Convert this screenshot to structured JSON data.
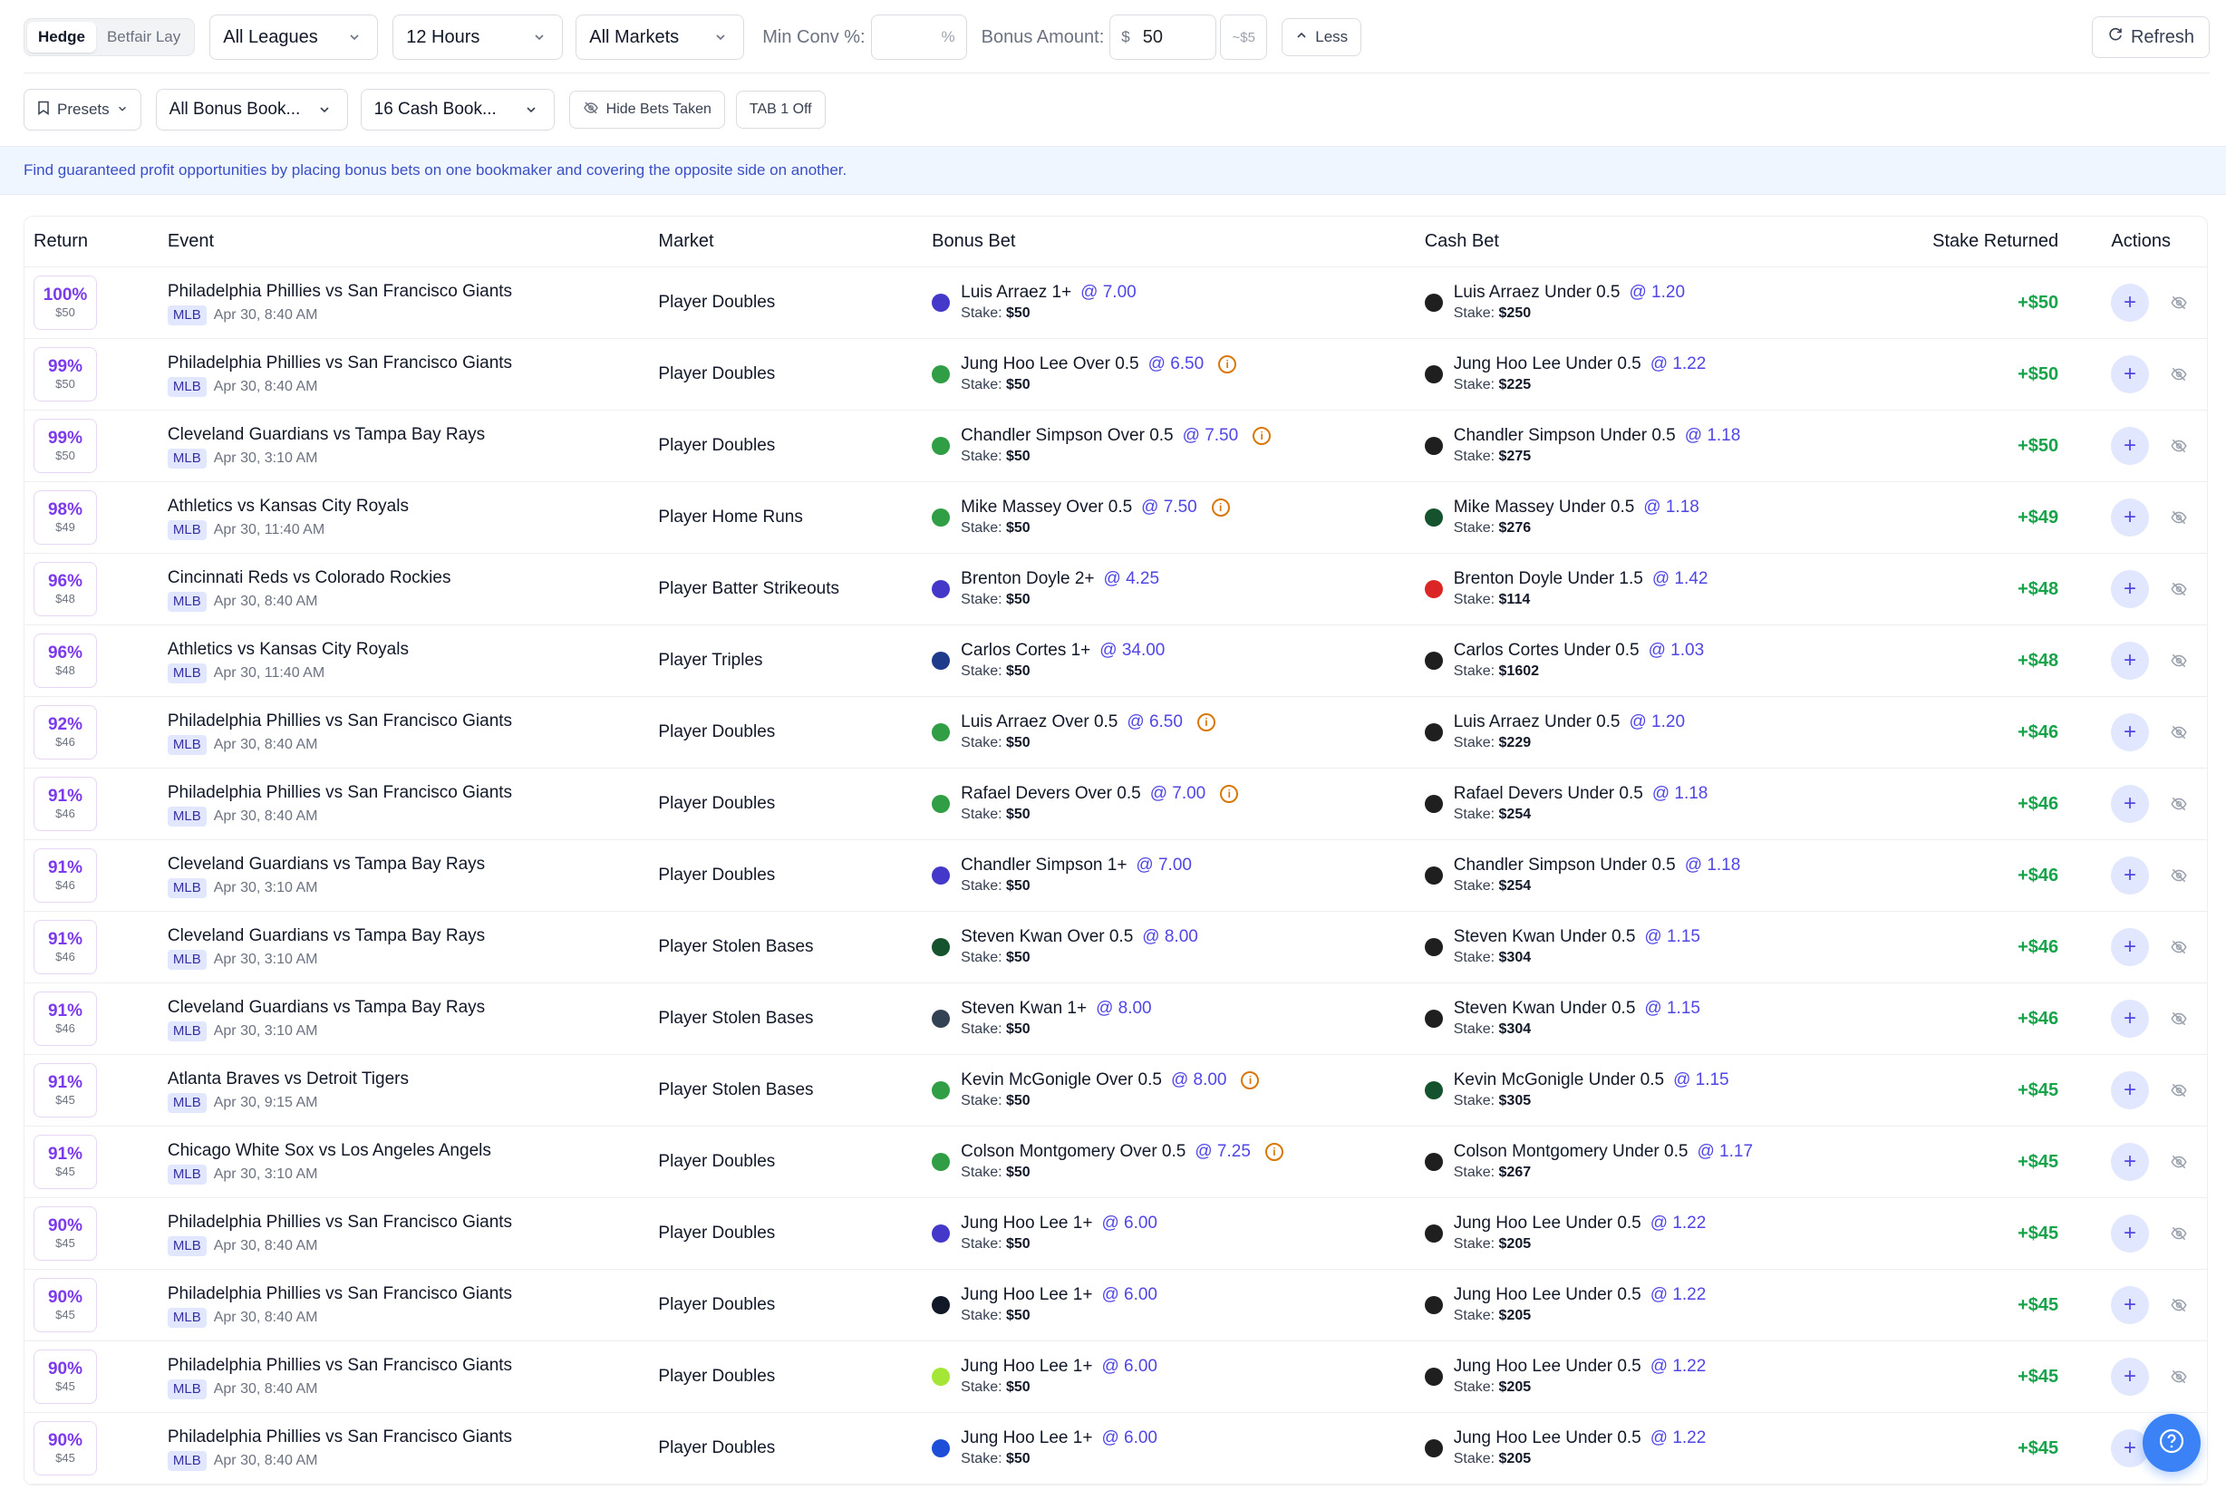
{
  "toolbar": {
    "mode_tabs": [
      "Hedge",
      "Betfair Lay"
    ],
    "league_select": "All Leagues",
    "time_select": "12 Hours",
    "market_select": "All Markets",
    "min_conv_label": "Min Conv %:",
    "min_conv_value": "",
    "min_conv_suffix": "%",
    "bonus_amount_label": "Bonus Amount:",
    "bonus_currency": "$",
    "bonus_amount_value": "50",
    "bonus_conv_hint": "~$5",
    "less_label": "Less",
    "refresh_label": "Refresh"
  },
  "filters": {
    "presets_label": "Presets",
    "bonus_books_select": "All Bonus Book...",
    "cash_books_select": "16 Cash Book...",
    "hide_bets_label": "Hide Bets Taken",
    "tab_toggle_label": "TAB 1 Off"
  },
  "info_text": "Find guaranteed profit opportunities by placing bonus bets on one bookmaker and covering the opposite side on another.",
  "columns": [
    "Return",
    "Event",
    "Market",
    "Bonus Bet",
    "Cash Bet",
    "Stake Returned",
    "Actions"
  ],
  "colors": {
    "accent": "#4f46e5",
    "profit": "#16a34a",
    "return": "#7c3aed",
    "warning": "#d97706"
  },
  "rows": [
    {
      "ret": "100%",
      "amt": "$50",
      "event": "Philadelphia Phillies vs San Francisco Giants",
      "league": "MLB",
      "time": "Apr 30, 8:40 AM",
      "market": "Player Doubles",
      "bonus_bet": "Luis Arraez 1+",
      "bonus_odds": "@ 7.00",
      "bonus_stake": "$50",
      "bonus_bk": "book-blue-d",
      "bonus_bk_color": "#4338ca",
      "warn": false,
      "cash_bet": "Luis Arraez Under 0.5",
      "cash_odds": "@ 1.20",
      "cash_stake": "$250",
      "cash_bk": "book-black-red",
      "cash_bk_color": "#1f1f1f",
      "returned": "+$50"
    },
    {
      "ret": "99%",
      "amt": "$50",
      "event": "Philadelphia Phillies vs San Francisco Giants",
      "league": "MLB",
      "time": "Apr 30, 8:40 AM",
      "market": "Player Doubles",
      "bonus_bet": "Jung Hoo Lee Over 0.5",
      "bonus_odds": "@ 6.50",
      "bonus_stake": "$50",
      "bonus_bk": "book-green",
      "bonus_bk_color": "#2f9e44",
      "warn": true,
      "cash_bet": "Jung Hoo Lee Under 0.5",
      "cash_odds": "@ 1.22",
      "cash_stake": "$225",
      "cash_bk": "book-black-red",
      "cash_bk_color": "#1f1f1f",
      "returned": "+$50"
    },
    {
      "ret": "99%",
      "amt": "$50",
      "event": "Cleveland Guardians vs Tampa Bay Rays",
      "league": "MLB",
      "time": "Apr 30, 3:10 AM",
      "market": "Player Doubles",
      "bonus_bet": "Chandler Simpson Over 0.5",
      "bonus_odds": "@ 7.50",
      "bonus_stake": "$50",
      "bonus_bk": "book-green",
      "bonus_bk_color": "#2f9e44",
      "warn": true,
      "cash_bet": "Chandler Simpson Under 0.5",
      "cash_odds": "@ 1.18",
      "cash_stake": "$275",
      "cash_bk": "book-black-red",
      "cash_bk_color": "#1f1f1f",
      "returned": "+$50"
    },
    {
      "ret": "98%",
      "amt": "$49",
      "event": "Athletics vs Kansas City Royals",
      "league": "MLB",
      "time": "Apr 30, 11:40 AM",
      "market": "Player Home Runs",
      "bonus_bet": "Mike Massey Over 0.5",
      "bonus_odds": "@ 7.50",
      "bonus_stake": "$50",
      "bonus_bk": "book-green",
      "bonus_bk_color": "#2f9e44",
      "warn": true,
      "cash_bet": "Mike Massey Under 0.5",
      "cash_odds": "@ 1.18",
      "cash_stake": "$276",
      "cash_bk": "book-darkgreen",
      "cash_bk_color": "#14532d",
      "returned": "+$49"
    },
    {
      "ret": "96%",
      "amt": "$48",
      "event": "Cincinnati Reds vs Colorado Rockies",
      "league": "MLB",
      "time": "Apr 30, 8:40 AM",
      "market": "Player Batter Strikeouts",
      "bonus_bet": "Brenton Doyle 2+",
      "bonus_odds": "@ 4.25",
      "bonus_stake": "$50",
      "bonus_bk": "book-blue-d",
      "bonus_bk_color": "#4338ca",
      "warn": false,
      "cash_bet": "Brenton Doyle Under 1.5",
      "cash_odds": "@ 1.42",
      "cash_stake": "$114",
      "cash_bk": "book-red",
      "cash_bk_color": "#dc2626",
      "returned": "+$48"
    },
    {
      "ret": "96%",
      "amt": "$48",
      "event": "Athletics vs Kansas City Royals",
      "league": "MLB",
      "time": "Apr 30, 11:40 AM",
      "market": "Player Triples",
      "bonus_bet": "Carlos Cortes 1+",
      "bonus_odds": "@ 34.00",
      "bonus_stake": "$50",
      "bonus_bk": "book-navy",
      "bonus_bk_color": "#1e3a8a",
      "warn": false,
      "cash_bet": "Carlos Cortes Under 0.5",
      "cash_odds": "@ 1.03",
      "cash_stake": "$1602",
      "cash_bk": "book-black-red",
      "cash_bk_color": "#1f1f1f",
      "returned": "+$48"
    },
    {
      "ret": "92%",
      "amt": "$46",
      "event": "Philadelphia Phillies vs San Francisco Giants",
      "league": "MLB",
      "time": "Apr 30, 8:40 AM",
      "market": "Player Doubles",
      "bonus_bet": "Luis Arraez Over 0.5",
      "bonus_odds": "@ 6.50",
      "bonus_stake": "$50",
      "bonus_bk": "book-green",
      "bonus_bk_color": "#2f9e44",
      "warn": true,
      "cash_bet": "Luis Arraez Under 0.5",
      "cash_odds": "@ 1.20",
      "cash_stake": "$229",
      "cash_bk": "book-black-red",
      "cash_bk_color": "#1f1f1f",
      "returned": "+$46"
    },
    {
      "ret": "91%",
      "amt": "$46",
      "event": "Philadelphia Phillies vs San Francisco Giants",
      "league": "MLB",
      "time": "Apr 30, 8:40 AM",
      "market": "Player Doubles",
      "bonus_bet": "Rafael Devers Over 0.5",
      "bonus_odds": "@ 7.00",
      "bonus_stake": "$50",
      "bonus_bk": "book-green",
      "bonus_bk_color": "#2f9e44",
      "warn": true,
      "cash_bet": "Rafael Devers Under 0.5",
      "cash_odds": "@ 1.18",
      "cash_stake": "$254",
      "cash_bk": "book-black-red",
      "cash_bk_color": "#1f1f1f",
      "returned": "+$46"
    },
    {
      "ret": "91%",
      "amt": "$46",
      "event": "Cleveland Guardians vs Tampa Bay Rays",
      "league": "MLB",
      "time": "Apr 30, 3:10 AM",
      "market": "Player Doubles",
      "bonus_bet": "Chandler Simpson 1+",
      "bonus_odds": "@ 7.00",
      "bonus_stake": "$50",
      "bonus_bk": "book-blue-d",
      "bonus_bk_color": "#4338ca",
      "warn": false,
      "cash_bet": "Chandler Simpson Under 0.5",
      "cash_odds": "@ 1.18",
      "cash_stake": "$254",
      "cash_bk": "book-black-red",
      "cash_bk_color": "#1f1f1f",
      "returned": "+$46"
    },
    {
      "ret": "91%",
      "amt": "$46",
      "event": "Cleveland Guardians vs Tampa Bay Rays",
      "league": "MLB",
      "time": "Apr 30, 3:10 AM",
      "market": "Player Stolen Bases",
      "bonus_bet": "Steven Kwan Over 0.5",
      "bonus_odds": "@ 8.00",
      "bonus_stake": "$50",
      "bonus_bk": "book-darkgreen",
      "bonus_bk_color": "#14532d",
      "warn": false,
      "cash_bet": "Steven Kwan Under 0.5",
      "cash_odds": "@ 1.15",
      "cash_stake": "$304",
      "cash_bk": "book-black-red",
      "cash_bk_color": "#1f1f1f",
      "returned": "+$46"
    },
    {
      "ret": "91%",
      "amt": "$46",
      "event": "Cleveland Guardians vs Tampa Bay Rays",
      "league": "MLB",
      "time": "Apr 30, 3:10 AM",
      "market": "Player Stolen Bases",
      "bonus_bet": "Steven Kwan 1+",
      "bonus_odds": "@ 8.00",
      "bonus_stake": "$50",
      "bonus_bk": "book-slate",
      "bonus_bk_color": "#334155",
      "warn": false,
      "cash_bet": "Steven Kwan Under 0.5",
      "cash_odds": "@ 1.15",
      "cash_stake": "$304",
      "cash_bk": "book-black-red",
      "cash_bk_color": "#1f1f1f",
      "returned": "+$46"
    },
    {
      "ret": "91%",
      "amt": "$45",
      "event": "Atlanta Braves vs Detroit Tigers",
      "league": "MLB",
      "time": "Apr 30, 9:15 AM",
      "market": "Player Stolen Bases",
      "bonus_bet": "Kevin McGonigle Over 0.5",
      "bonus_odds": "@ 8.00",
      "bonus_stake": "$50",
      "bonus_bk": "book-green",
      "bonus_bk_color": "#2f9e44",
      "warn": true,
      "cash_bet": "Kevin McGonigle Under 0.5",
      "cash_odds": "@ 1.15",
      "cash_stake": "$305",
      "cash_bk": "book-darkgreen",
      "cash_bk_color": "#14532d",
      "returned": "+$45"
    },
    {
      "ret": "91%",
      "amt": "$45",
      "event": "Chicago White Sox vs Los Angeles Angels",
      "league": "MLB",
      "time": "Apr 30, 3:10 AM",
      "market": "Player Doubles",
      "bonus_bet": "Colson Montgomery Over 0.5",
      "bonus_odds": "@ 7.25",
      "bonus_stake": "$50",
      "bonus_bk": "book-green",
      "bonus_bk_color": "#2f9e44",
      "warn": true,
      "cash_bet": "Colson Montgomery Under 0.5",
      "cash_odds": "@ 1.17",
      "cash_stake": "$267",
      "cash_bk": "book-black-red",
      "cash_bk_color": "#1f1f1f",
      "returned": "+$45"
    },
    {
      "ret": "90%",
      "amt": "$45",
      "event": "Philadelphia Phillies vs San Francisco Giants",
      "league": "MLB",
      "time": "Apr 30, 8:40 AM",
      "market": "Player Doubles",
      "bonus_bet": "Jung Hoo Lee 1+",
      "bonus_odds": "@ 6.00",
      "bonus_stake": "$50",
      "bonus_bk": "book-blue-d",
      "bonus_bk_color": "#4338ca",
      "warn": false,
      "cash_bet": "Jung Hoo Lee Under 0.5",
      "cash_odds": "@ 1.22",
      "cash_stake": "$205",
      "cash_bk": "book-black-red",
      "cash_bk_color": "#1f1f1f",
      "returned": "+$45"
    },
    {
      "ret": "90%",
      "amt": "$45",
      "event": "Philadelphia Phillies vs San Francisco Giants",
      "league": "MLB",
      "time": "Apr 30, 8:40 AM",
      "market": "Player Doubles",
      "bonus_bet": "Jung Hoo Lee 1+",
      "bonus_odds": "@ 6.00",
      "bonus_stake": "$50",
      "bonus_bk": "book-dark",
      "bonus_bk_color": "#111827",
      "warn": false,
      "cash_bet": "Jung Hoo Lee Under 0.5",
      "cash_odds": "@ 1.22",
      "cash_stake": "$205",
      "cash_bk": "book-black-red",
      "cash_bk_color": "#1f1f1f",
      "returned": "+$45"
    },
    {
      "ret": "90%",
      "amt": "$45",
      "event": "Philadelphia Phillies vs San Francisco Giants",
      "league": "MLB",
      "time": "Apr 30, 8:40 AM",
      "market": "Player Doubles",
      "bonus_bet": "Jung Hoo Lee 1+",
      "bonus_odds": "@ 6.00",
      "bonus_stake": "$50",
      "bonus_bk": "book-lime",
      "bonus_bk_color": "#a3e635",
      "warn": false,
      "cash_bet": "Jung Hoo Lee Under 0.5",
      "cash_odds": "@ 1.22",
      "cash_stake": "$205",
      "cash_bk": "book-black-red",
      "cash_bk_color": "#1f1f1f",
      "returned": "+$45"
    },
    {
      "ret": "90%",
      "amt": "$45",
      "event": "Philadelphia Phillies vs San Francisco Giants",
      "league": "MLB",
      "time": "Apr 30, 8:40 AM",
      "market": "Player Doubles",
      "bonus_bet": "Jung Hoo Lee 1+",
      "bonus_odds": "@ 6.00",
      "bonus_stake": "$50",
      "bonus_bk": "book-blue-b",
      "bonus_bk_color": "#1d4ed8",
      "warn": false,
      "cash_bet": "Jung Hoo Lee Under 0.5",
      "cash_odds": "@ 1.22",
      "cash_stake": "$205",
      "cash_bk": "book-black-red",
      "cash_bk_color": "#1f1f1f",
      "returned": "+$45"
    }
  ]
}
